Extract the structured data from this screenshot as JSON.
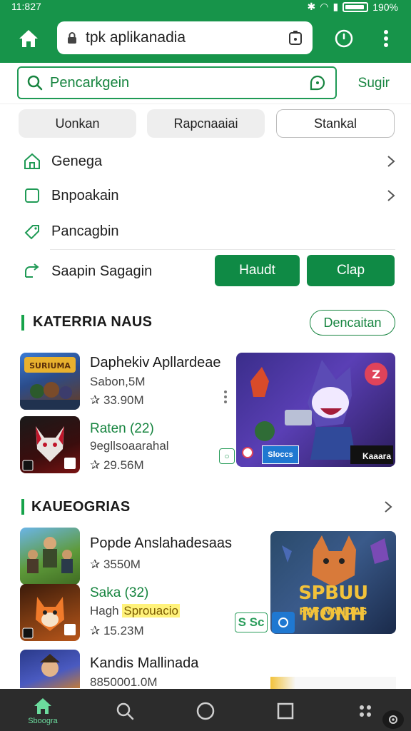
{
  "status": {
    "time": "11:827",
    "battery": "190%"
  },
  "browser": {
    "url": "tpk aplikanadia"
  },
  "search": {
    "value": "Pencarkgein",
    "suggest_label": "Sugir"
  },
  "chips": [
    {
      "label": "Uonkan"
    },
    {
      "label": "Rapcnaaiai"
    },
    {
      "label": "Stankal"
    }
  ],
  "menu": [
    {
      "label": "Genega",
      "icon": "house-outline-icon"
    },
    {
      "label": "Bnpoakain",
      "icon": "square-outline-icon"
    },
    {
      "label": "Pancagbin",
      "icon": "tag-icon"
    },
    {
      "label": "Saapin Sagagin",
      "icon": "share-icon"
    }
  ],
  "action_buttons": {
    "primary": "Haudt",
    "secondary": "Clap"
  },
  "section1": {
    "title": "KATERRIA NAUS",
    "action": "Dencaitan",
    "apps": [
      {
        "name": "Daphekiv Apllardeae",
        "meta1": "Sabon,5M",
        "meta2": "✰ 33.90M",
        "icon": "game-thumb-icon"
      },
      {
        "name": "Raten (22)",
        "meta1": "9egllsoaarahal",
        "meta2": "✰ 29.56M",
        "icon": "fox-thumb-icon"
      }
    ],
    "banner_caption": "Kaaara",
    "banner_badge": "Sloccs"
  },
  "section2": {
    "title": "KAUEOGRIAS",
    "apps": [
      {
        "name": "Popde Anslahadesaas",
        "meta1": "",
        "meta2": "✰ 3550M",
        "icon": "soldiers-thumb-icon"
      },
      {
        "name": "Saka (32)",
        "meta1": "Hagh",
        "highlight": "Sprouacio",
        "meta2": "✰ 15.23M",
        "icon": "fox2-thumb-icon"
      },
      {
        "name": "Kandis Mallinada",
        "meta1": "",
        "meta2": "8850001.0M",
        "icon": "hero-thumb-icon"
      }
    ],
    "banner_title": "SPBUU MONH",
    "banner_subtitle": "RAF NANDAS",
    "mini_label": "S Sc"
  },
  "bottomnav": {
    "home_label": "Sboogra"
  },
  "colors": {
    "brand_green": "#17944a",
    "button_green": "#0f8a45",
    "nav_bg": "#2c2c2c"
  }
}
